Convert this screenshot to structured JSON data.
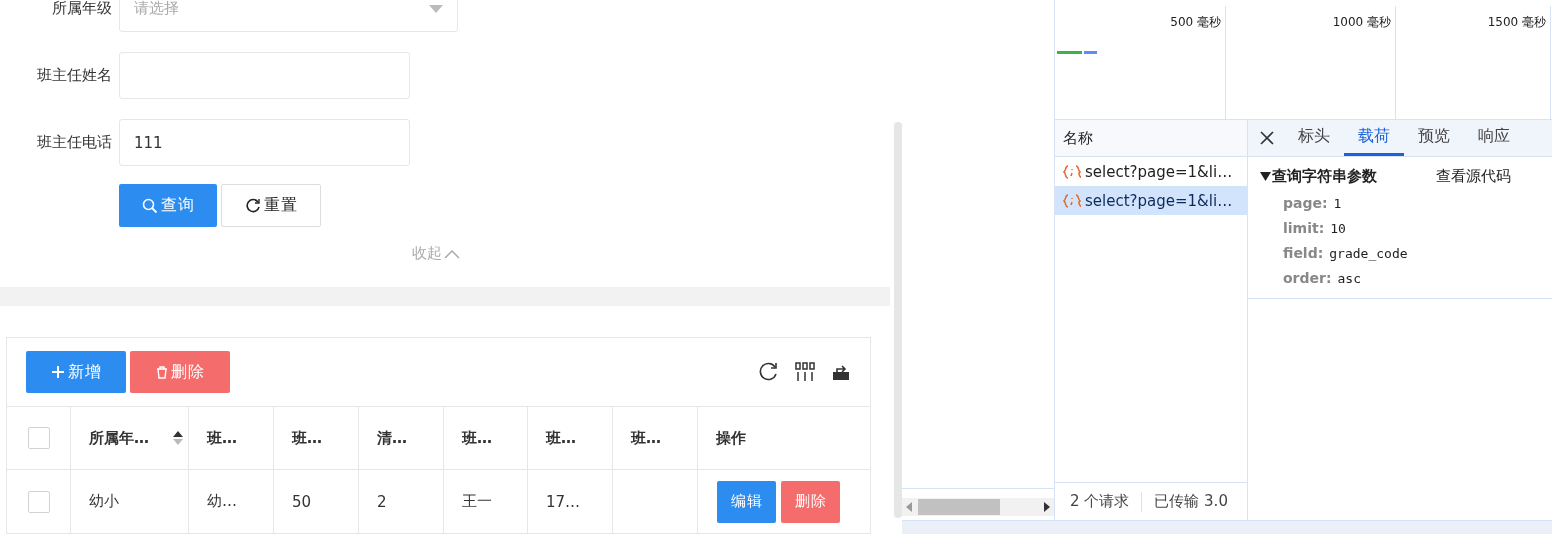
{
  "form": {
    "fields": [
      {
        "label": "所属年级",
        "kind": "select",
        "placeholder": "请选择"
      },
      {
        "label": "班主任姓名",
        "kind": "input"
      },
      {
        "label": "班主任电话",
        "kind": "input",
        "value": "111"
      }
    ],
    "buttons": [
      {
        "label": "查询",
        "kind": "primary"
      },
      {
        "label": "重置",
        "kind": "default"
      }
    ],
    "collapse": "收起"
  },
  "toolbar": {
    "buttons": [
      {
        "label": "新增",
        "kind": "primary"
      },
      {
        "label": "删除",
        "kind": "danger"
      }
    ]
  },
  "table": {
    "all_checked": false,
    "columns": [
      {
        "label": "所属年…",
        "sortable": true
      },
      {
        "label": "班…",
        "sortable": false
      },
      {
        "label": "班…",
        "sortable": false
      },
      {
        "label": "清…",
        "sortable": false
      },
      {
        "label": "班…",
        "sortable": false
      },
      {
        "label": "班…",
        "sortable": false
      },
      {
        "label": "班…",
        "sortable": false
      },
      {
        "label": "操作",
        "sortable": false
      }
    ],
    "rows": [
      {
        "checked": false,
        "cells": [
          "幼小",
          "幼…",
          "50",
          "2",
          "王一",
          "17…",
          null
        ],
        "actions": [
          {
            "label": "编辑",
            "kind": "primary"
          },
          {
            "label": "删除",
            "kind": "danger"
          }
        ]
      }
    ]
  },
  "timeline": {
    "ticks": [
      "500 毫秒",
      "1000 毫秒",
      "1500 毫秒"
    ]
  },
  "requests": {
    "header": "名称",
    "items": [
      {
        "name": "select?page=1&li…",
        "selected": false
      },
      {
        "name": "select?page=1&li…",
        "selected": true
      }
    ],
    "summary": [
      "2 个请求",
      "已传输 3.0"
    ]
  },
  "details": {
    "tabs": [
      {
        "label": "标头",
        "selected": false
      },
      {
        "label": "载荷",
        "selected": true
      },
      {
        "label": "预览",
        "selected": false
      },
      {
        "label": "响应",
        "selected": false
      }
    ],
    "section": {
      "title": "查询字符串参数",
      "expanded": true,
      "action": "查看源代码",
      "params": [
        {
          "key": "page:",
          "value": "1"
        },
        {
          "key": "limit:",
          "value": "10"
        },
        {
          "key": "field:",
          "value": "grade_code"
        },
        {
          "key": "order:",
          "value": "asc"
        }
      ]
    }
  }
}
